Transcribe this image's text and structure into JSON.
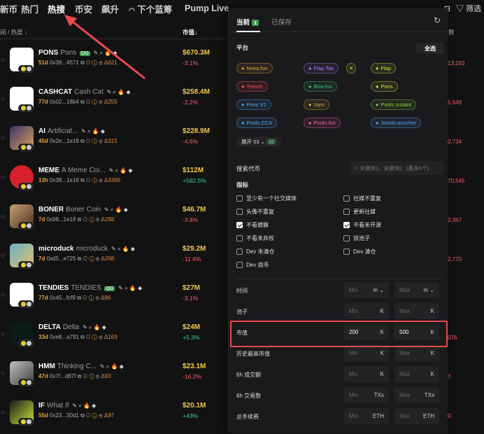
{
  "nav": {
    "tabs": [
      "新币",
      "热门",
      "热搜",
      "币安",
      "飙升",
      "下个蓝筹",
      "Pump Live"
    ],
    "active": "热搜",
    "filter_label": "筛选"
  },
  "list_header": {
    "left": "间 / 热度 ↓",
    "mcap": "市值↓",
    "right": "数"
  },
  "rows": [
    {
      "symbol": "PONS",
      "name": "Pons",
      "tag": "OG",
      "age": "51d",
      "addr": "0x39...4571",
      "fire": "621",
      "mcap": "$670.3M",
      "chg": "-3.1%",
      "dir": "neg",
      "right": "13,293",
      "img": "pons"
    },
    {
      "symbol": "CASHCAT",
      "name": "Cash Cat",
      "tag": "",
      "age": "77d",
      "addr": "0x02...18b4",
      "fire": "255",
      "mcap": "$258.4M",
      "chg": "-2.2%",
      "dir": "neg",
      "right": "5,649",
      "img": "cashcat"
    },
    {
      "symbol": "AI",
      "name": "Artificial...",
      "tag": "",
      "age": "45d",
      "addr": "0x2e...1e18",
      "fire": "315",
      "mcap": "$228.9M",
      "chg": "-4.6%",
      "dir": "neg",
      "right": "0,734",
      "img": "ai"
    },
    {
      "symbol": "MEME",
      "name": "A Meme Coi...",
      "tag": "",
      "age": "13h",
      "addr": "0x38...1e18",
      "fire": "3366",
      "mcap": "$112M",
      "chg": "+582.5%",
      "dir": "pos",
      "right": "70,545",
      "img": "amc"
    },
    {
      "symbol": "BONER",
      "name": "Boner Coin",
      "tag": "",
      "age": "7d",
      "addr": "0x98...1e18",
      "fire": "288",
      "mcap": "$46.7M",
      "chg": "-3.8%",
      "dir": "neg",
      "right": "2,367",
      "img": "boner"
    },
    {
      "symbol": "microduck",
      "name": "microduck",
      "tag": "",
      "age": "7d",
      "addr": "0xd5...e725",
      "fire": "268",
      "mcap": "$29.2M",
      "chg": "-11.4%",
      "dir": "neg",
      "right": "2,770",
      "img": "duck"
    },
    {
      "symbol": "TENDIES",
      "name": "TENDIES",
      "tag": "OG",
      "age": "77d",
      "addr": "0x45...fcf9",
      "fire": "96",
      "mcap": "$27M",
      "chg": "-3.1%",
      "dir": "neg",
      "right": "",
      "img": "tendies"
    },
    {
      "symbol": "DELTA",
      "name": "Delta",
      "tag": "",
      "age": "33d",
      "addr": "0xe8...a791",
      "fire": "163",
      "mcap": "$24M",
      "chg": "+5.3%",
      "dir": "pos",
      "right": "076",
      "img": "delta"
    },
    {
      "symbol": "HMM",
      "name": "Thinking C...",
      "tag": "",
      "age": "47d",
      "addr": "0x7f...d87f",
      "fire": "93",
      "mcap": "$23.1M",
      "chg": "-16.2%",
      "dir": "neg",
      "right": "7",
      "img": "hmm"
    },
    {
      "symbol": "IF",
      "name": "What If",
      "tag": "",
      "age": "55d",
      "addr": "0x23...30d1",
      "fire": "97",
      "mcap": "$20.1M",
      "chg": "+43%",
      "dir": "pos",
      "right": "0",
      "img": "if"
    }
  ],
  "panel": {
    "tab_current": "当前",
    "tab_current_count": "1",
    "tab_saved": "已保存",
    "platform_label": "平台",
    "select_all": "全选",
    "platforms": [
      {
        "label": "Noxa.fun",
        "color": "#e0a93b"
      },
      {
        "label": "Flap Tax",
        "color": "#a77bff"
      },
      {
        "label": "Flap",
        "color": "#d7e233"
      },
      {
        "label": "Trench",
        "color": "#ff5757"
      },
      {
        "label": "Bow.fun",
        "color": "#3ec17a"
      },
      {
        "label": "Pons",
        "color": "#d7e233"
      },
      {
        "label": "Pons V2",
        "color": "#4aa6ff"
      },
      {
        "label": "Varo",
        "color": "#e0a93b"
      },
      {
        "label": "Pools Instant",
        "color": "#8ad236"
      },
      {
        "label": "Pools CCA",
        "color": "#4aa6ff"
      },
      {
        "label": "Pools.fun",
        "color": "#ff5fa8"
      },
      {
        "label": "StonkLauncher",
        "color": "#4aa6ff"
      }
    ],
    "expand_label": "展开 53",
    "expand_count": "32",
    "search_label": "搜索代币",
    "search_placeholder": "关键词1，关键词2...(最多5个)",
    "indicators_label": "指标",
    "checks": [
      {
        "label": "至少有一个社交媒体",
        "checked": false
      },
      {
        "label": "社媒不重复",
        "checked": false
      },
      {
        "label": "头像不重复",
        "checked": false
      },
      {
        "label": "更新社媒",
        "checked": false
      },
      {
        "label": "不看貔貅",
        "checked": true
      },
      {
        "label": "不看未开源",
        "checked": true
      },
      {
        "label": "不看未弃权",
        "checked": false
      },
      {
        "label": "锁池子",
        "checked": false
      },
      {
        "label": "Dev 未清仓",
        "checked": false
      },
      {
        "label": "Dev 清仓",
        "checked": false
      },
      {
        "label": "Dev 烧币",
        "checked": false
      }
    ],
    "filters": [
      {
        "label": "时间",
        "min": "Min",
        "max": "Max",
        "unit": "m",
        "min_filled": false,
        "max_filled": false
      },
      {
        "label": "池子",
        "min": "Min",
        "max": "Max",
        "unit": "K",
        "min_filled": false,
        "max_filled": false
      },
      {
        "label": "市值",
        "min": "200",
        "max": "500",
        "unit": "K",
        "min_filled": true,
        "max_filled": true
      },
      {
        "label": "历史最高市值",
        "min": "Min",
        "max": "Max",
        "unit": "K",
        "min_filled": false,
        "max_filled": false
      },
      {
        "label": "6h 成交额",
        "min": "Min",
        "max": "Max",
        "unit": "K",
        "min_filled": false,
        "max_filled": false
      },
      {
        "label": "6h 交易数",
        "min": "Min",
        "max": "Max",
        "unit": "TXs",
        "min_filled": false,
        "max_filled": false
      },
      {
        "label": "总手续费",
        "min": "Min",
        "max": "Max",
        "unit": "ETH",
        "min_filled": false,
        "max_filled": false
      }
    ]
  },
  "colors": {
    "accent_red": "#e94a4a",
    "mcap_yellow": "#f1c84b",
    "pos": "#37d39a",
    "neg": "#ff5b6b"
  }
}
